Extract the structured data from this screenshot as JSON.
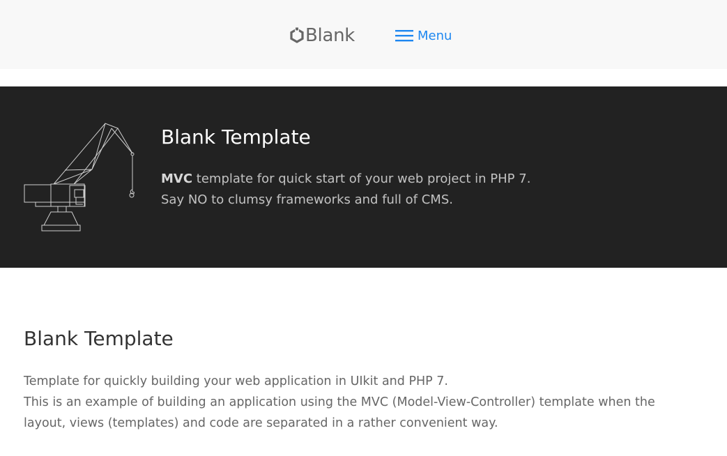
{
  "navbar": {
    "logo_text": "Blank",
    "menu_label": "Menu",
    "menu_color": "#1e87f0",
    "background": "#f8f8f8"
  },
  "hero": {
    "title": "Blank Template",
    "line1_strong": "MVC",
    "line1_rest": " template for quick start of your web project in PHP 7.",
    "line2": "Say NO to clumsy frameworks and full of CMS.",
    "illustration": "crane-icon",
    "background": "#222222"
  },
  "content": {
    "title": "Blank Template",
    "line1": "Template for quickly building your web application in UIkit and PHP 7.",
    "line2": "This is an example of building an application using the MVC (Model-View-Controller) template when the layout, views (templates) and code are separated in a rather convenient way."
  }
}
